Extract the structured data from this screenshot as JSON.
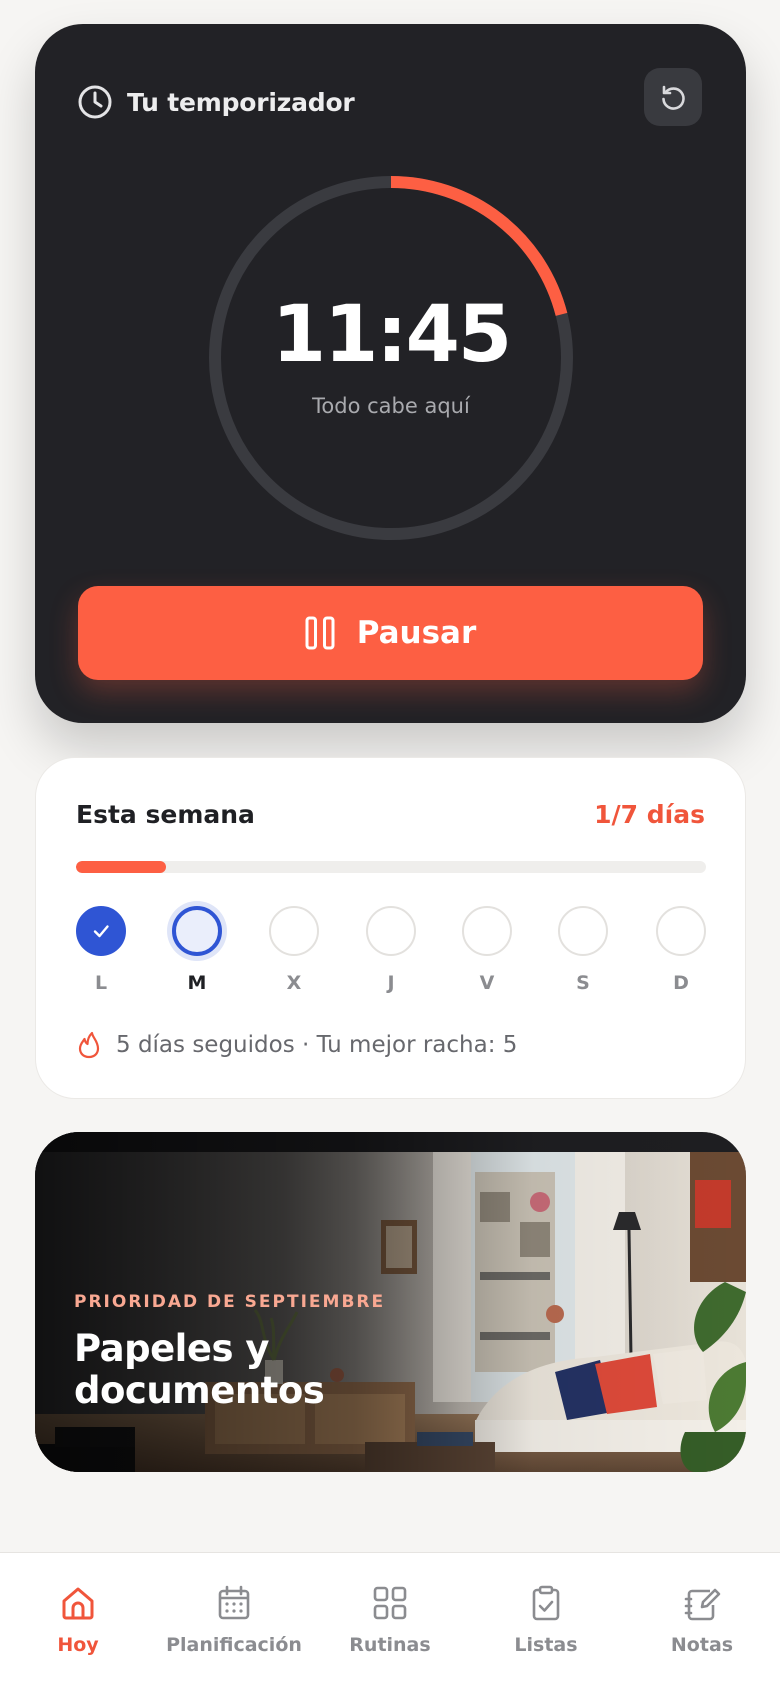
{
  "timer": {
    "title": "Tu temporizador",
    "time": "11:45",
    "subtitle": "Todo cabe aquí",
    "progress_fraction": 0.21,
    "pause_label": "Pausar"
  },
  "week": {
    "title": "Esta semana",
    "count": "1/7 días",
    "progress_fraction": 0.143,
    "days": [
      {
        "letter": "L",
        "state": "done"
      },
      {
        "letter": "M",
        "state": "today"
      },
      {
        "letter": "X",
        "state": "empty"
      },
      {
        "letter": "J",
        "state": "empty"
      },
      {
        "letter": "V",
        "state": "empty"
      },
      {
        "letter": "S",
        "state": "empty"
      },
      {
        "letter": "D",
        "state": "empty"
      }
    ],
    "streak": "5 días seguidos · Tu mejor racha: 5"
  },
  "priority": {
    "eyebrow": "PRIORIDAD DE SEPTIEMBRE",
    "title": "Papeles y documentos"
  },
  "nav": {
    "items": [
      {
        "label": "Hoy",
        "icon": "home-icon",
        "active": true
      },
      {
        "label": "Planificación",
        "icon": "calendar-icon",
        "active": false
      },
      {
        "label": "Rutinas",
        "icon": "grid-icon",
        "active": false
      },
      {
        "label": "Listas",
        "icon": "clipboard-check-icon",
        "active": false
      },
      {
        "label": "Notas",
        "icon": "edit-note-icon",
        "active": false
      }
    ]
  },
  "colors": {
    "accent": "#fd5f43",
    "accent_text": "#f0553b",
    "card_dark": "#222226",
    "blue": "#2f55d4"
  }
}
